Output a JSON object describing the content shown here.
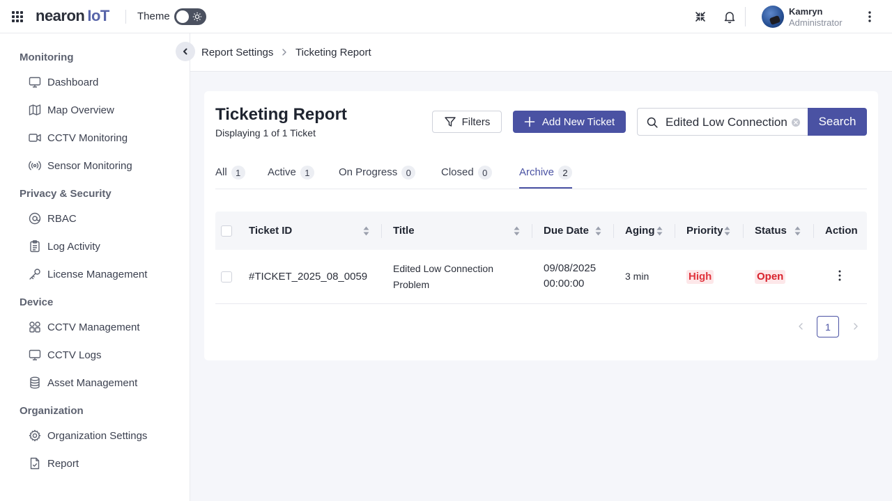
{
  "header": {
    "logo_main": "nearon",
    "logo_suffix": "IoT",
    "theme_label": "Theme",
    "user": {
      "name": "Kamryn",
      "role": "Administrator"
    }
  },
  "sidebar": {
    "sections": [
      {
        "title": "Monitoring",
        "items": [
          {
            "label": "Dashboard",
            "icon": "monitor-icon"
          },
          {
            "label": "Map Overview",
            "icon": "map-icon"
          },
          {
            "label": "CCTV Monitoring",
            "icon": "video-camera-icon"
          },
          {
            "label": "Sensor Monitoring",
            "icon": "signal-icon"
          }
        ]
      },
      {
        "title": "Privacy & Security",
        "items": [
          {
            "label": "RBAC",
            "icon": "at-sign-icon"
          },
          {
            "label": "Log Activity",
            "icon": "clipboard-icon"
          },
          {
            "label": "License Management",
            "icon": "key-icon"
          }
        ]
      },
      {
        "title": "Device",
        "items": [
          {
            "label": "CCTV Management",
            "icon": "grid-icon"
          },
          {
            "label": "CCTV Logs",
            "icon": "monitor-icon"
          },
          {
            "label": "Asset Management",
            "icon": "database-icon"
          }
        ]
      },
      {
        "title": "Organization",
        "items": [
          {
            "label": "Organization Settings",
            "icon": "gear-icon"
          },
          {
            "label": "Report",
            "icon": "file-check-icon"
          }
        ]
      }
    ]
  },
  "breadcrumb": {
    "parent": "Report Settings",
    "current": "Ticketing Report"
  },
  "page": {
    "title": "Ticketing Report",
    "subtitle": "Displaying 1 of 1 Ticket",
    "filters_label": "Filters",
    "add_label": "Add New Ticket",
    "search_value": "Edited Low Connection Problem",
    "search_button": "Search"
  },
  "tabs": [
    {
      "label": "All",
      "count": "1"
    },
    {
      "label": "Active",
      "count": "1"
    },
    {
      "label": "On Progress",
      "count": "0"
    },
    {
      "label": "Closed",
      "count": "0"
    },
    {
      "label": "Archive",
      "count": "2"
    }
  ],
  "active_tab": "Archive",
  "table": {
    "columns": [
      "Ticket ID",
      "Title",
      "Due Date",
      "Aging",
      "Priority",
      "Status",
      "Action"
    ],
    "rows": [
      {
        "ticket_id": "#TICKET_2025_08_0059",
        "title_line1": "Edited Low Connection",
        "title_line2": "Problem",
        "due_date": "09/08/2025",
        "due_time": "00:00:00",
        "aging": "3 min",
        "priority": "High",
        "status": "Open"
      }
    ]
  },
  "pagination": {
    "current_page": "1"
  },
  "colors": {
    "primary": "#4a52a3",
    "danger_text": "#e0353e",
    "danger_bg": "#fde7e9",
    "page_bg": "#f5f6fa"
  }
}
